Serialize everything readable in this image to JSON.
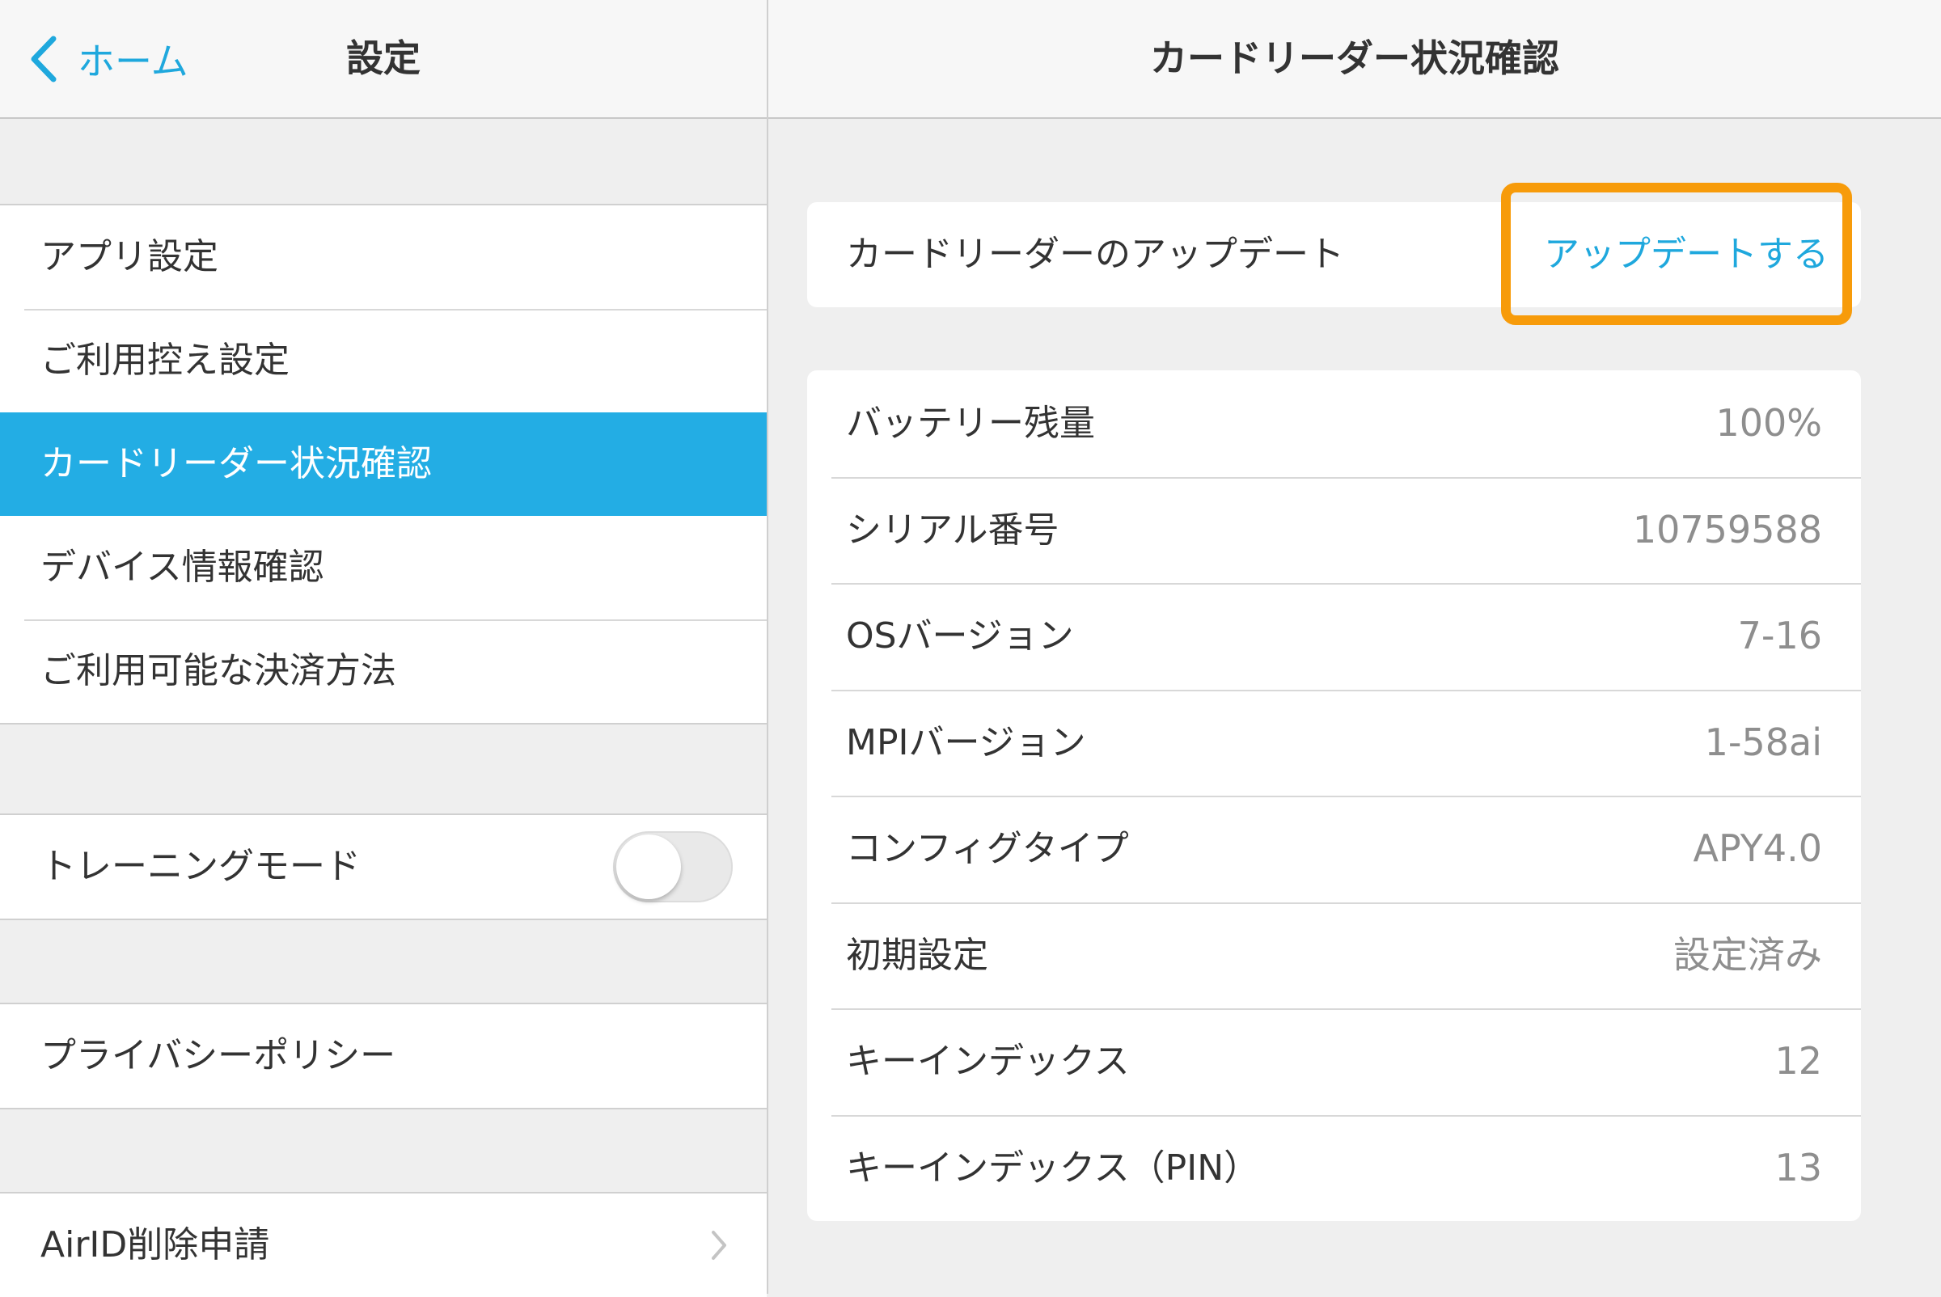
{
  "colors": {
    "accent": "#1fa8dd",
    "selected_bg": "#23ade4",
    "highlight": "#f79b0a"
  },
  "left": {
    "nav": {
      "back_label": "ホーム",
      "back_icon": "chevron-left-icon",
      "title": "設定"
    },
    "group1": [
      {
        "label": "アプリ設定"
      },
      {
        "label": "ご利用控え設定"
      },
      {
        "label": "カードリーダー状況確認",
        "selected": true
      },
      {
        "label": "デバイス情報確認"
      },
      {
        "label": "ご利用可能な決済方法"
      }
    ],
    "training": {
      "label": "トレーニングモード",
      "toggle_on": false
    },
    "privacy": {
      "label": "プライバシーポリシー"
    },
    "airid": {
      "label": "AirID削除申請",
      "icon": "chevron-right-icon"
    }
  },
  "right": {
    "nav": {
      "title": "カードリーダー状況確認"
    },
    "update": {
      "label": "カードリーダーのアップデート",
      "action": "アップデートする"
    },
    "info": [
      {
        "label": "バッテリー残量",
        "value": "100%"
      },
      {
        "label": "シリアル番号",
        "value": "10759588"
      },
      {
        "label": "OSバージョン",
        "value": "7-16"
      },
      {
        "label": "MPIバージョン",
        "value": "1-58ai"
      },
      {
        "label": "コンフィグタイプ",
        "value": "APY4.0"
      },
      {
        "label": "初期設定",
        "value": "設定済み"
      },
      {
        "label": "キーインデックス",
        "value": "12"
      },
      {
        "label": "キーインデックス（PIN）",
        "value": "13"
      }
    ]
  }
}
